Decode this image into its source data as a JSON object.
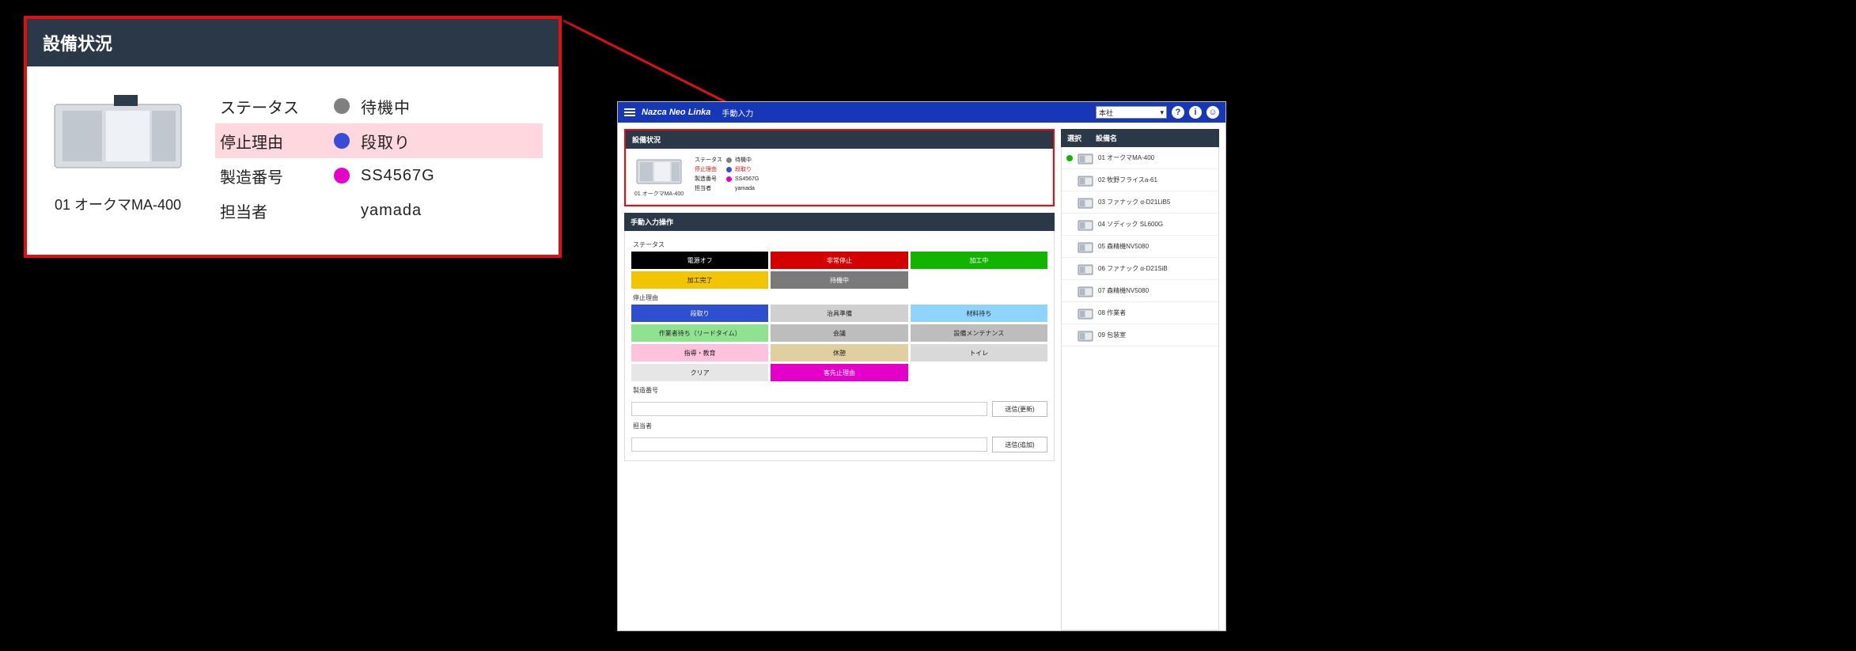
{
  "zoom": {
    "header": "設備状況",
    "machine_label": "01 オークマMA-400",
    "rows": {
      "status_k": "ステータス",
      "status_v": "待機中",
      "reason_k": "停止理由",
      "reason_v": "段取り",
      "serial_k": "製造番号",
      "serial_v": "SS4567G",
      "person_k": "担当者",
      "person_v": "yamada"
    }
  },
  "app": {
    "brand": "Nazca Neo Linka",
    "crumb": "手動入力",
    "branch_select": "本社",
    "left": {
      "equip_header": "設備状況",
      "mini_machine": "01 オークマMA-400",
      "mini_rows": {
        "status_k": "ステータス",
        "status_v": "待機中",
        "reason_k": "停止理由",
        "reason_v": "段取り",
        "serial_k": "製造番号",
        "serial_v": "SS4567G",
        "person_k": "担当者",
        "person_v": "yamada"
      },
      "ops_header": "手動入力操作",
      "sec_status": "ステータス",
      "status_btns": [
        {
          "label": "電源オフ",
          "bg": "#000000",
          "txt": "#fff"
        },
        {
          "label": "非常停止",
          "bg": "#d40000",
          "txt": "#fff"
        },
        {
          "label": "加工中",
          "bg": "#12b400",
          "txt": "#fff"
        },
        {
          "label": "加工完了",
          "bg": "#f3c400",
          "txt": "#222"
        },
        {
          "label": "待機中",
          "bg": "#7a7a7a",
          "txt": "#fff"
        }
      ],
      "sec_reason": "停止理由",
      "reason_btns": [
        {
          "label": "段取り",
          "bg": "#2e4fd0",
          "txt": "#fff"
        },
        {
          "label": "治具準備",
          "bg": "#d0d0d0",
          "txt": "#222"
        },
        {
          "label": "材料待ち",
          "bg": "#8fd3ff",
          "txt": "#222"
        },
        {
          "label": "作業者待ち（リードタイム）",
          "bg": "#8fe28f",
          "txt": "#222"
        },
        {
          "label": "会議",
          "bg": "#bdbdbd",
          "txt": "#222"
        },
        {
          "label": "設備メンテナンス",
          "bg": "#bdbdbd",
          "txt": "#222"
        },
        {
          "label": "指導・教育",
          "bg": "#ffc1dc",
          "txt": "#222"
        },
        {
          "label": "休憩",
          "bg": "#e0cfa0",
          "txt": "#222"
        },
        {
          "label": "トイレ",
          "bg": "#d9d9d9",
          "txt": "#222"
        },
        {
          "label": "クリア",
          "bg": "#e6e6e6",
          "txt": "#222"
        },
        {
          "label": "客先止理由",
          "bg": "#e400c9",
          "txt": "#fff"
        }
      ],
      "sec_serial": "製造番号",
      "sec_person": "担当者",
      "btn_update": "送信(更新)",
      "btn_add": "送信(追加)"
    },
    "right": {
      "col_select": "選択",
      "col_name": "設備名",
      "items": [
        {
          "name": "01 オークマMA-400",
          "sel": true
        },
        {
          "name": "02 牧野フライスa-61",
          "sel": false
        },
        {
          "name": "03 ファナック α-D21LiB5",
          "sel": false
        },
        {
          "name": "04 ソディック SL600G",
          "sel": false
        },
        {
          "name": "05 森精機NV5080",
          "sel": false
        },
        {
          "name": "06 ファナック α-D21SiB",
          "sel": false
        },
        {
          "name": "07 森精機NV5080",
          "sel": false
        },
        {
          "name": "08 作業者",
          "sel": false
        },
        {
          "name": "09 包装室",
          "sel": false
        }
      ]
    }
  }
}
